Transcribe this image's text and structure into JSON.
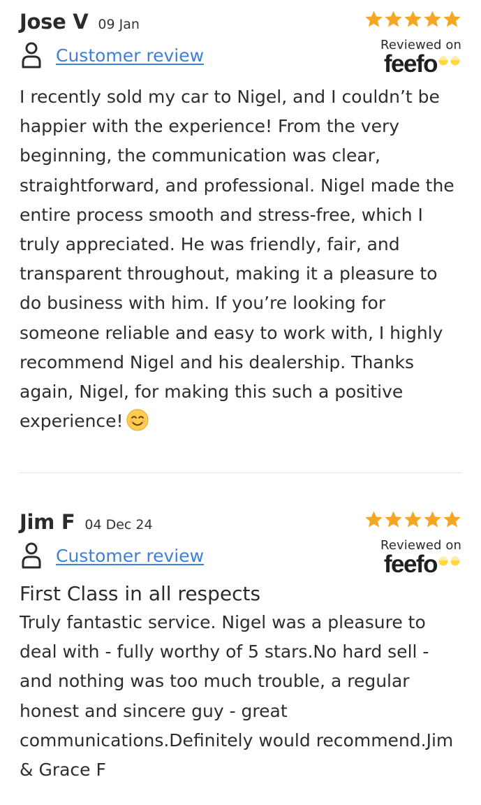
{
  "reviews": [
    {
      "name": "Jose V",
      "date": "09 Jan",
      "type_label": "Customer review",
      "rating": 5,
      "rating_max": 5,
      "reviewed_on": "Reviewed on",
      "brand": "feefo",
      "title": "",
      "body": "I recently sold my car to Nigel, and I couldn’t be happier with the experience! From the very beginning, the communication was clear, straightforward, and professional. Nigel made the entire process smooth and stress-free, which I truly appreciated. He was friendly, fair, and transparent throughout, making it a pleasure to do business with him. If you’re looking for someone reliable and easy to work with, I highly recommend Nigel and his dealership. Thanks again, Nigel, for making this such a positive experience!",
      "emoji": "smiling-face-icon"
    },
    {
      "name": "Jim F",
      "date": "04 Dec 24",
      "type_label": "Customer review",
      "rating": 5,
      "rating_max": 5,
      "reviewed_on": "Reviewed on",
      "brand": "feefo",
      "title": "First Class in all respects",
      "body": "Truly fantastic service. Nigel was a pleasure to deal with - fully worthy of 5 stars.No hard sell - and nothing was too much trouble, a regular honest and sincere guy - great communications.Definitely would recommend.Jim & Grace F"
    }
  ],
  "colors": {
    "star": "#f5a623",
    "link": "#3d7fd9",
    "feefo_eyes": "#ffd83d",
    "divider": "#e2e2e2"
  }
}
